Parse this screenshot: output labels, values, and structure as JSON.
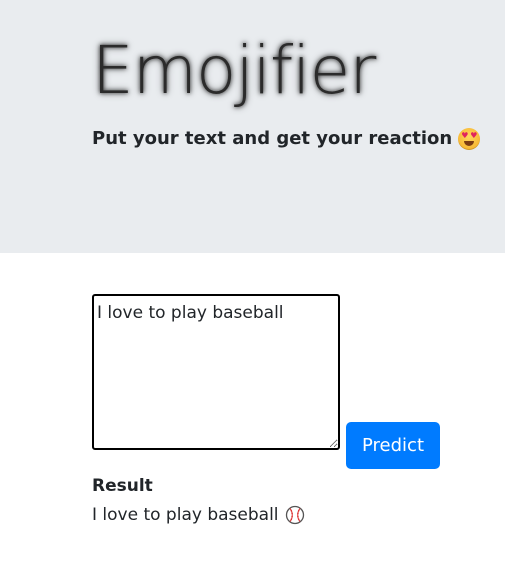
{
  "header": {
    "title": "Emojifier",
    "subtitle": "Put your text and get your reaction",
    "subtitle_icon": "heart-eyes-emoji-icon"
  },
  "form": {
    "input_value": "I love to play baseball",
    "predict_label": "Predict"
  },
  "result": {
    "label": "Result",
    "text": "I love to play baseball",
    "emoji_icon": "baseball-emoji-icon"
  },
  "colors": {
    "header_bg": "#e9ecef",
    "button_primary": "#007bff",
    "text": "#212529"
  }
}
